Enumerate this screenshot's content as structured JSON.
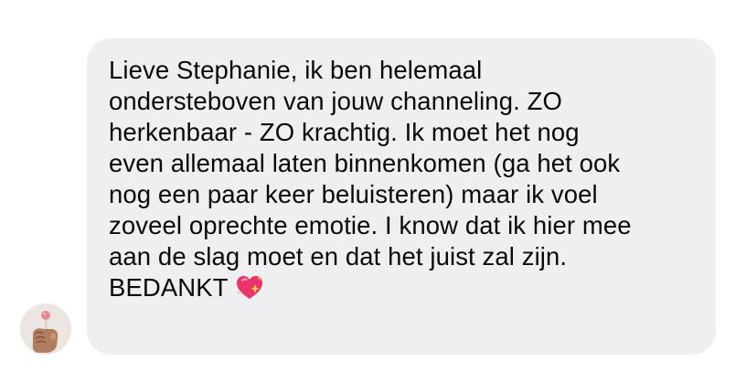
{
  "message": {
    "lines": [
      "Lieve Stephanie, ik ben helemaal",
      "ondersteboven van jouw channeling. ZO",
      "herkenbaar - ZO krachtig. Ik moet het nog",
      "even allemaal laten binnenkomen (ga het ook",
      "nog een paar keer beluisteren) maar ik voel",
      "zoveel oprechte emotie. I know dat ik hier mee",
      "aan de slag moet en dat het juist zal zijn.",
      "BEDANKT"
    ],
    "trailing_emoji": "sparkling-heart-icon"
  },
  "sender": {
    "avatar": "avatar-photo"
  },
  "colors": {
    "bubble": "#efeff1",
    "text": "#0a0a0a",
    "heart": "#e8336d",
    "sparkle": "#f7c948"
  }
}
